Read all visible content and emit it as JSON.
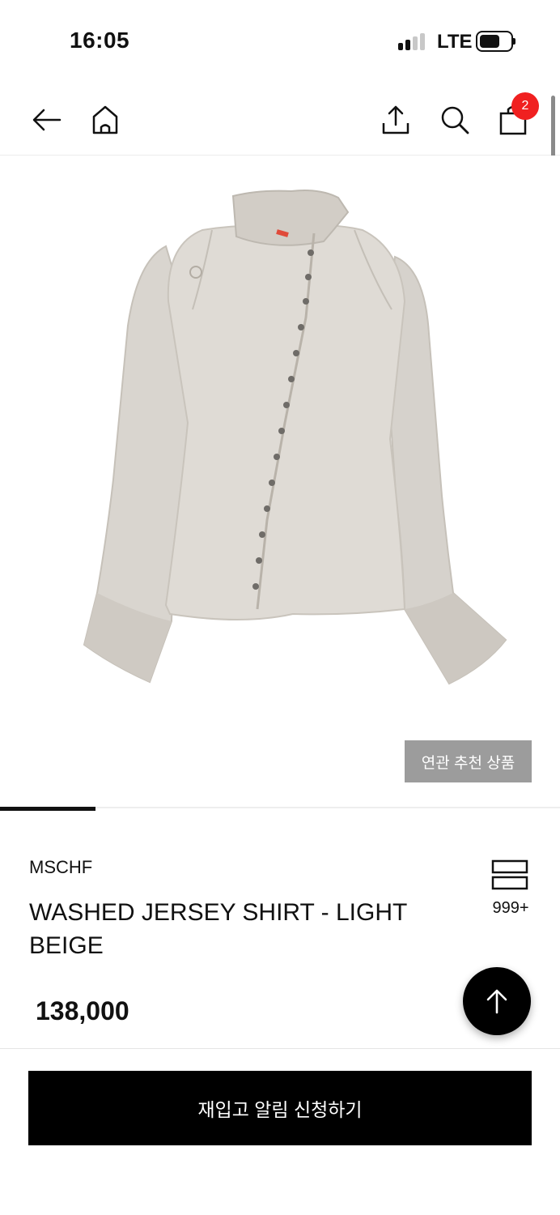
{
  "status_bar": {
    "time": "16:05",
    "network": "LTE",
    "signal_icon": "cellular-signal-icon",
    "battery_icon": "battery-icon"
  },
  "header": {
    "back_icon": "arrow-left-icon",
    "home_icon": "home-icon",
    "share_icon": "share-icon",
    "search_icon": "search-icon",
    "cart_icon": "shopping-bag-icon",
    "cart_count": "2",
    "badge_color": "#f02020"
  },
  "product": {
    "image_description": "light beige washed jersey shirt",
    "related_button_label": "연관 추천 상품",
    "brand": "MSCHF",
    "name": "WASHED JERSEY SHIRT - LIGHT BEIGE",
    "like_icon": "wishlist-icon",
    "like_count": "999+",
    "price": "138,000",
    "image_gallery_progress": 0.17
  },
  "actions": {
    "scroll_top_icon": "arrow-up-icon",
    "restock_button_label": "재입고 알림 신청하기"
  }
}
